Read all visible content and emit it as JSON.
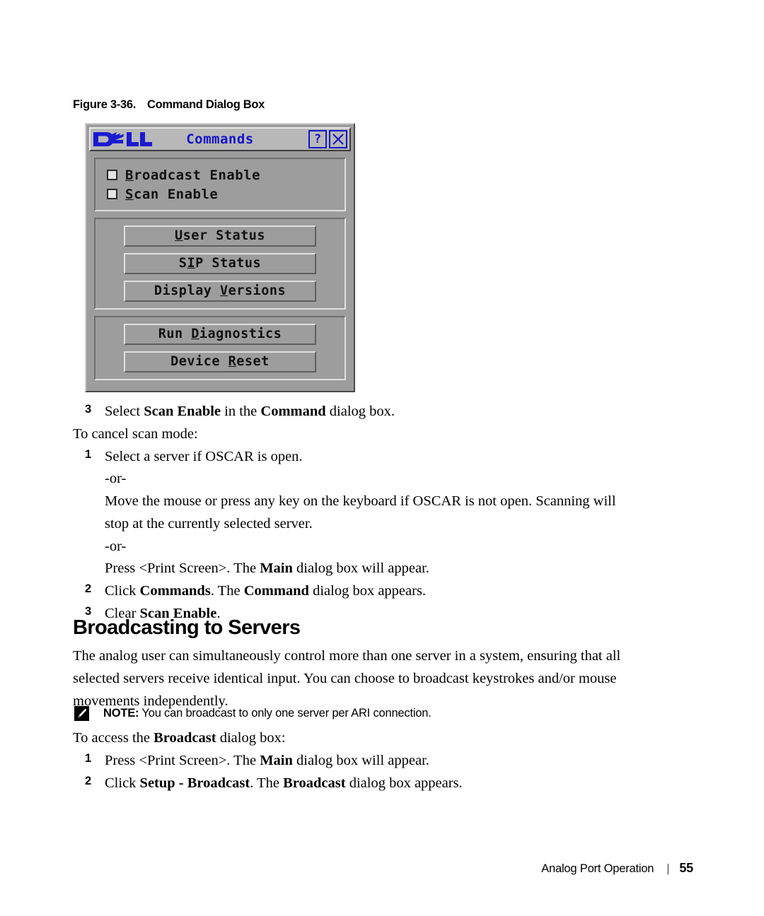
{
  "figure": {
    "number": "Figure 3-36.",
    "title": "Command Dialog Box"
  },
  "dialog": {
    "brand": "DELL",
    "title": "Commands",
    "help_button": "?",
    "close_button": "X",
    "checkboxes": [
      {
        "label_pre": "",
        "mnemonic": "B",
        "label_post": "roadcast Enable",
        "checked": false
      },
      {
        "label_pre": "",
        "mnemonic": "S",
        "label_post": "can Enable",
        "checked": false
      }
    ],
    "button_group_1": [
      {
        "pre": "",
        "mnemonic": "U",
        "post": "ser Status"
      },
      {
        "pre": "S",
        "mnemonic": "I",
        "post": "P Status"
      },
      {
        "pre": "Display ",
        "mnemonic": "V",
        "post": "ersions"
      }
    ],
    "button_group_2": [
      {
        "pre": "Run ",
        "mnemonic": "D",
        "post": "iagnostics"
      },
      {
        "pre": "Device ",
        "mnemonic": "R",
        "post": "eset"
      }
    ]
  },
  "content": {
    "step_3a_num": "3",
    "step_3a_pre": "Select ",
    "step_3a_b1": "Scan Enable",
    "step_3a_mid": " in the ",
    "step_3a_b2": "Command",
    "step_3a_post": " dialog box.",
    "cancel_intro": "To cancel scan mode:",
    "step_1a_num": "1",
    "step_1a_text": "Select a server if OSCAR is open.",
    "or_1": "-or-",
    "move_mouse": "Move the mouse or press any key on the keyboard if OSCAR is not open. Scanning will stop at the currently selected server.",
    "or_2": "-or-",
    "press_pre": "Press <Print Screen>. The ",
    "press_b": "Main",
    "press_post": " dialog box will appear.",
    "step_2a_num": "2",
    "step_2a_pre": "Click ",
    "step_2a_b1": "Commands",
    "step_2a_mid": ". The ",
    "step_2a_b2": "Command",
    "step_2a_post": " dialog box appears.",
    "step_3b_num": "3",
    "step_3b_pre": "Clear ",
    "step_3b_b1": "Scan Enable",
    "step_3b_post": ".",
    "heading": "Broadcasting to Servers",
    "intro_para": "The analog user can simultaneously control more than one server in a system, ensuring that all selected servers receive identical input. You can choose to broadcast keystrokes and/or mouse movements independently.",
    "note_label": "NOTE:",
    "note_text": " You can broadcast to only one server per ARI connection.",
    "access_pre": "To access the ",
    "access_b": "Broadcast",
    "access_post": " dialog box:",
    "step_1b_num": "1",
    "step_1b_pre": "Press <Print Screen>. The ",
    "step_1b_b": "Main",
    "step_1b_post": " dialog box will appear.",
    "step_2b_num": "2",
    "step_2b_pre": "Click ",
    "step_2b_b1": "Setup - Broadcast",
    "step_2b_mid": ". The ",
    "step_2b_b2": "Broadcast",
    "step_2b_post": " dialog box appears."
  },
  "footer": {
    "chapter": "Analog Port Operation",
    "separator": "|",
    "page": "55"
  },
  "colors": {
    "dell_blue": "#1414c8",
    "dialog_face": "#9d9d9d",
    "titlebar_face": "#b8b8b8"
  }
}
